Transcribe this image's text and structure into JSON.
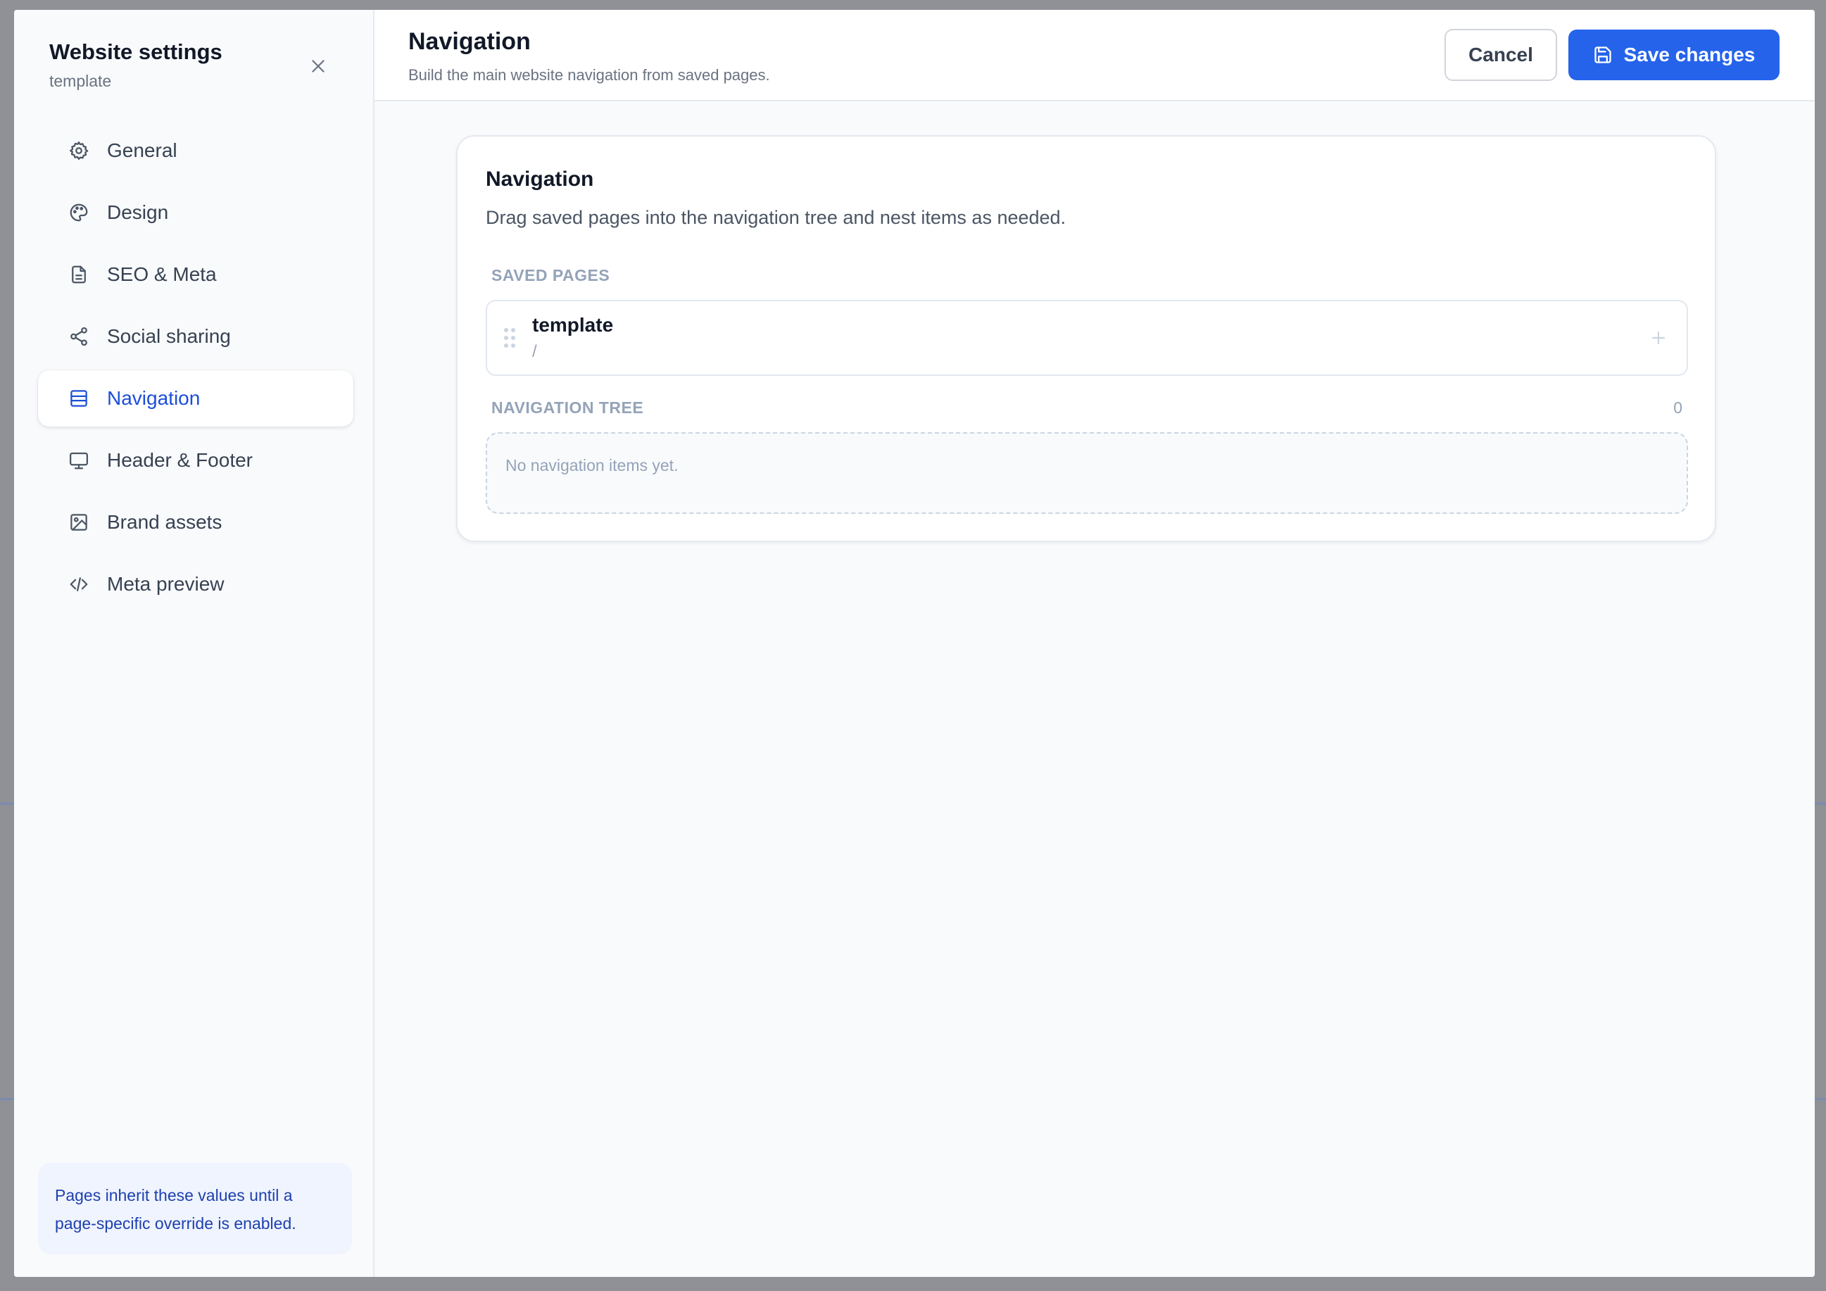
{
  "sidebar": {
    "title": "Website settings",
    "subtitle": "template",
    "items": [
      {
        "label": "General",
        "icon": "gear-icon",
        "active": false
      },
      {
        "label": "Design",
        "icon": "palette-icon",
        "active": false
      },
      {
        "label": "SEO & Meta",
        "icon": "document-icon",
        "active": false
      },
      {
        "label": "Social sharing",
        "icon": "share-icon",
        "active": false
      },
      {
        "label": "Navigation",
        "icon": "navigation-list-icon",
        "active": true
      },
      {
        "label": "Header & Footer",
        "icon": "monitor-icon",
        "active": false
      },
      {
        "label": "Brand assets",
        "icon": "image-icon",
        "active": false
      },
      {
        "label": "Meta preview",
        "icon": "code-icon",
        "active": false
      }
    ],
    "note": "Pages inherit these values until a page-specific override is enabled."
  },
  "header": {
    "title": "Navigation",
    "subtitle": "Build the main website navigation from saved pages.",
    "cancel_label": "Cancel",
    "save_label": "Save changes"
  },
  "card": {
    "title": "Navigation",
    "description": "Drag saved pages into the navigation tree and nest items as needed.",
    "saved_pages_label": "SAVED PAGES",
    "saved_pages": [
      {
        "name": "template",
        "path": "/"
      }
    ],
    "tree_label": "NAVIGATION TREE",
    "tree_count": "0",
    "empty_text": "No navigation items yet."
  },
  "colors": {
    "accent": "#2563eb",
    "active_text": "#1d4ed8",
    "overlay": "#8f9197"
  }
}
